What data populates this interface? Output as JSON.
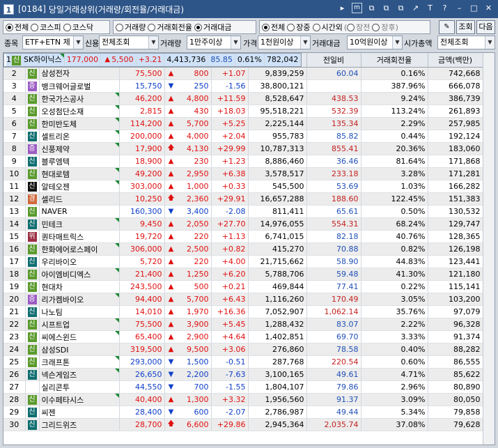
{
  "window": {
    "number": "1",
    "screen_code": "[0184]",
    "title": "당일거래상위(거래량/회전율/거래대금)",
    "tools": [
      "▸",
      "m",
      "⧉",
      "⧉",
      "⧉",
      "↗",
      "T",
      "?",
      "–",
      "□",
      "✕"
    ]
  },
  "market": {
    "options": [
      "전체",
      "코스피",
      "코스닥"
    ],
    "selected": "전체"
  },
  "sort": {
    "options": [
      "거래량",
      "거래회전율",
      "거래대금"
    ],
    "selected": "거래대금"
  },
  "session": {
    "options": [
      "전체",
      "장중",
      "시간외"
    ],
    "selected": "전체",
    "sub_options": [
      "장전",
      "장후"
    ]
  },
  "buttons": {
    "query": "조회",
    "next": "다음"
  },
  "filters": {
    "stock_label": "종목",
    "stock_value": "ETF+ETN 제",
    "credit_label": "신용",
    "credit_value": "전체조회",
    "volume_label": "거래량",
    "volume_value": "1만주이상",
    "price_label": "가격",
    "price_value": "1천원이상",
    "amount_label": "거래대금",
    "amount_value": "10억원이상",
    "cap_label": "시가총액",
    "cap_value": "전체조회"
  },
  "table": {
    "columns": [
      "순위",
      "분",
      "종목명",
      "현재가",
      "전일대비",
      "등락률",
      "거래량",
      "전일비",
      "거래회전율",
      "금액(백만)"
    ],
    "rows": [
      {
        "rank": "1",
        "type": "신",
        "name": "SK하이닉스",
        "price": "177,000",
        "dir": "up",
        "change": "5,500",
        "rate": "+3.21",
        "volume": "4,413,736",
        "prev": "85.85",
        "turnover": "0.61%",
        "amount": "782,042",
        "flag": true
      },
      {
        "rank": "2",
        "type": "신",
        "name": "삼성전자",
        "price": "75,500",
        "dir": "up",
        "change": "800",
        "rate": "+1.07",
        "volume": "9,839,259",
        "prev": "60.04",
        "turnover": "0.16%",
        "amount": "742,668",
        "flag": false
      },
      {
        "rank": "3",
        "type": "증",
        "name": "뱅크웨어글로벌",
        "price": "15,750",
        "dir": "down",
        "change": "250",
        "rate": "-1.56",
        "volume": "38,800,121",
        "prev": "",
        "turnover": "387.96%",
        "amount": "666,078",
        "flag": false
      },
      {
        "rank": "4",
        "type": "신",
        "name": "한국가스공사",
        "price": "46,200",
        "dir": "up",
        "change": "4,800",
        "rate": "+11.59",
        "volume": "8,528,647",
        "prev": "438.53",
        "turnover": "9.24%",
        "amount": "386,739",
        "flag": true
      },
      {
        "rank": "5",
        "type": "신",
        "name": "오성첨단소재",
        "price": "2,815",
        "dir": "up",
        "change": "430",
        "rate": "+18.03",
        "volume": "95,518,221",
        "prev": "532.39",
        "turnover": "113.24%",
        "amount": "261,893",
        "flag": true
      },
      {
        "rank": "6",
        "type": "신",
        "name": "한미반도체",
        "price": "114,200",
        "dir": "up",
        "change": "5,700",
        "rate": "+5.25",
        "volume": "2,225,144",
        "prev": "135.34",
        "turnover": "2.29%",
        "amount": "257,985",
        "flag": true
      },
      {
        "rank": "7",
        "type": "신",
        "name": "셀트리온",
        "price": "200,000",
        "dir": "up",
        "change": "4,000",
        "rate": "+2.04",
        "volume": "955,783",
        "prev": "85.82",
        "turnover": "0.44%",
        "amount": "192,124",
        "flag": true
      },
      {
        "rank": "8",
        "type": "증",
        "name": "신풍제약",
        "price": "17,900",
        "dir": "upper",
        "change": "4,130",
        "rate": "+29.99",
        "volume": "10,787,313",
        "prev": "855.41",
        "turnover": "20.36%",
        "amount": "183,060",
        "flag": true
      },
      {
        "rank": "9",
        "type": "신",
        "name": "블루엠텍",
        "price": "18,900",
        "dir": "up",
        "change": "230",
        "rate": "+1.23",
        "volume": "8,886,460",
        "prev": "36.46",
        "turnover": "81.64%",
        "amount": "171,868",
        "flag": false
      },
      {
        "rank": "10",
        "type": "신",
        "name": "현대로템",
        "price": "49,200",
        "dir": "up",
        "change": "2,950",
        "rate": "+6.38",
        "volume": "3,578,517",
        "prev": "233.18",
        "turnover": "3.28%",
        "amount": "171,281",
        "flag": true
      },
      {
        "rank": "11",
        "type": "신",
        "name": "알테오젠",
        "price": "303,000",
        "dir": "up",
        "change": "1,000",
        "rate": "+0.33",
        "volume": "545,500",
        "prev": "53.69",
        "turnover": "1.03%",
        "amount": "166,282",
        "flag": true
      },
      {
        "rank": "12",
        "type": "경",
        "name": "셀리드",
        "price": "10,250",
        "dir": "upper",
        "change": "2,360",
        "rate": "+29.91",
        "volume": "16,657,288",
        "prev": "188.60",
        "turnover": "122.45%",
        "amount": "151,383",
        "flag": false
      },
      {
        "rank": "13",
        "type": "신",
        "name": "NAVER",
        "price": "160,300",
        "dir": "down",
        "change": "3,400",
        "rate": "-2.08",
        "volume": "811,411",
        "prev": "65.61",
        "turnover": "0.50%",
        "amount": "130,532",
        "flag": false
      },
      {
        "rank": "14",
        "type": "신",
        "name": "민테크",
        "price": "9,450",
        "dir": "up",
        "change": "2,050",
        "rate": "+27.70",
        "volume": "14,976,055",
        "prev": "554.31",
        "turnover": "68.24%",
        "amount": "129,747",
        "flag": true
      },
      {
        "rank": "15",
        "type": "위",
        "name": "퀀타매트릭스",
        "price": "19,720",
        "dir": "up",
        "change": "220",
        "rate": "+1.13",
        "volume": "6,741,015",
        "prev": "82.18",
        "turnover": "40.76%",
        "amount": "128,365",
        "flag": false
      },
      {
        "rank": "16",
        "type": "신",
        "name": "한화에어로스페이",
        "price": "306,000",
        "dir": "up",
        "change": "2,500",
        "rate": "+0.82",
        "volume": "415,270",
        "prev": "70.88",
        "turnover": "0.82%",
        "amount": "126,198",
        "flag": true
      },
      {
        "rank": "17",
        "type": "신",
        "name": "우리바이오",
        "price": "5,720",
        "dir": "up",
        "change": "220",
        "rate": "+4.00",
        "volume": "21,715,662",
        "prev": "58.90",
        "turnover": "44.83%",
        "amount": "123,441",
        "flag": false
      },
      {
        "rank": "18",
        "type": "신",
        "name": "아이엠비디엑스",
        "price": "21,400",
        "dir": "up",
        "change": "1,250",
        "rate": "+6.20",
        "volume": "5,788,706",
        "prev": "59.48",
        "turnover": "41.30%",
        "amount": "121,180",
        "flag": true
      },
      {
        "rank": "19",
        "type": "신",
        "name": "현대차",
        "price": "243,500",
        "dir": "up",
        "change": "500",
        "rate": "+0.21",
        "volume": "469,844",
        "prev": "77.41",
        "turnover": "0.22%",
        "amount": "115,141",
        "flag": false
      },
      {
        "rank": "20",
        "type": "증",
        "name": "리가켐바이오",
        "price": "94,400",
        "dir": "up",
        "change": "5,700",
        "rate": "+6.43",
        "volume": "1,116,260",
        "prev": "170.49",
        "turnover": "3.05%",
        "amount": "103,200",
        "flag": true
      },
      {
        "rank": "21",
        "type": "신",
        "name": "나노팀",
        "price": "14,010",
        "dir": "up",
        "change": "1,970",
        "rate": "+16.36",
        "volume": "7,052,907",
        "prev": "1,062.14",
        "turnover": "35.76%",
        "amount": "97,079",
        "flag": false
      },
      {
        "rank": "22",
        "type": "신",
        "name": "시프트업",
        "price": "75,500",
        "dir": "up",
        "change": "3,900",
        "rate": "+5.45",
        "volume": "1,288,432",
        "prev": "83.07",
        "turnover": "2.22%",
        "amount": "96,328",
        "flag": true
      },
      {
        "rank": "23",
        "type": "신",
        "name": "씨에스윈드",
        "price": "65,400",
        "dir": "up",
        "change": "2,900",
        "rate": "+4.64",
        "volume": "1,402,851",
        "prev": "69.70",
        "turnover": "3.33%",
        "amount": "91,374",
        "flag": true
      },
      {
        "rank": "24",
        "type": "신",
        "name": "삼성SDI",
        "price": "319,500",
        "dir": "up",
        "change": "9,500",
        "rate": "+3.06",
        "volume": "276,860",
        "prev": "78.58",
        "turnover": "0.40%",
        "amount": "88,282",
        "flag": false
      },
      {
        "rank": "25",
        "type": "신",
        "name": "크래프톤",
        "price": "293,000",
        "dir": "down",
        "change": "1,500",
        "rate": "-0.51",
        "volume": "287,768",
        "prev": "220.54",
        "turnover": "0.60%",
        "amount": "86,555",
        "flag": true
      },
      {
        "rank": "26",
        "type": "신",
        "name": "넥슨게임즈",
        "price": "26,650",
        "dir": "down",
        "change": "2,200",
        "rate": "-7.63",
        "volume": "3,100,165",
        "prev": "49.61",
        "turnover": "4.71%",
        "amount": "85,622",
        "flag": true
      },
      {
        "rank": "27",
        "type": "",
        "name": "실리콘투",
        "price": "44,550",
        "dir": "down",
        "change": "700",
        "rate": "-1.55",
        "volume": "1,804,107",
        "prev": "79.86",
        "turnover": "2.96%",
        "amount": "80,890",
        "flag": false
      },
      {
        "rank": "28",
        "type": "신",
        "name": "이수페타시스",
        "price": "40,400",
        "dir": "up",
        "change": "1,300",
        "rate": "+3.32",
        "volume": "1,956,560",
        "prev": "91.37",
        "turnover": "3.09%",
        "amount": "80,050",
        "flag": true
      },
      {
        "rank": "29",
        "type": "신",
        "name": "씨젠",
        "price": "28,400",
        "dir": "down",
        "change": "600",
        "rate": "-2.07",
        "volume": "2,786,987",
        "prev": "49.44",
        "turnover": "5.34%",
        "amount": "79,858",
        "flag": false
      },
      {
        "rank": "30",
        "type": "신",
        "name": "그리드위즈",
        "price": "28,700",
        "dir": "upper",
        "change": "6,600",
        "rate": "+29.86",
        "volume": "2,945,364",
        "prev": "2,035.74",
        "turnover": "37.08%",
        "amount": "79,628",
        "flag": false
      }
    ]
  },
  "colors": {
    "title_bar": "#2e5588",
    "up": "#e01010",
    "down": "#1040c8",
    "selected_row": "#cfe2f7"
  }
}
